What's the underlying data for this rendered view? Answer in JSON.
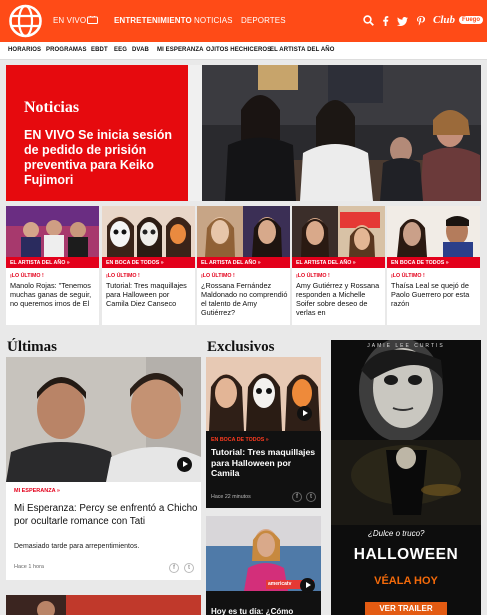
{
  "header": {
    "nav": [
      {
        "label": "EN VIVO"
      },
      {
        "label": "ENTRETENIMIENTO"
      },
      {
        "label": "NOTICIAS"
      },
      {
        "label": "DEPORTES"
      }
    ],
    "club_label": "Club",
    "club_badge": "Fuego",
    "brand_color": "#ff4b17"
  },
  "subnav": [
    "HORARIOS",
    "PROGRAMAS",
    "EBDT",
    "EEG",
    "DVAB",
    "MI ESPERANZA",
    "OJITOS HECHICEROS",
    "EL ARTISTA DEL AÑO"
  ],
  "hero": {
    "section": "Noticias",
    "title": "EN VIVO Se inicia sesión de pedido de prisión preventiva para Keiko Fujimori"
  },
  "cards": [
    {
      "tag": "EL ARTISTA DEL AÑO »",
      "kicker": "¡LO ÚLTIMO !",
      "title": "Manolo Rojas: \"Tenemos muchas ganas de seguir, no queremos irnos de El"
    },
    {
      "tag": "EN BOCA DE TODOS »",
      "kicker": "¡LO ÚLTIMO !",
      "title": "Tutorial: Tres maquillajes para Halloween por Camila Diez Canseco"
    },
    {
      "tag": "EL ARTISTA DEL AÑO »",
      "kicker": "¡LO ÚLTIMO !",
      "title": "¿Rossana Fernández Maldonado no comprendió el talento de Amy Gutiérrez?"
    },
    {
      "tag": "EL ARTISTA DEL AÑO »",
      "kicker": "¡LO ÚLTIMO !",
      "title": "Amy Gutiérrez y Rossana responden a Michelle Soifer sobre deseo de verlas en"
    },
    {
      "tag": "EN BOCA DE TODOS »",
      "kicker": "¡LO ÚLTIMO !",
      "title": "Thaísa Leal se quejó de Paolo Guerrero por esta razón"
    }
  ],
  "ultimas": {
    "heading": "Últimas",
    "kicker": "MI ESPERANZA »",
    "title": "Mi Esperanza: Percy se enfrentó a Chicho por ocultarle romance con Tati",
    "description": "Demasiado tarde para arrepentimientos.",
    "time": "Hace 1 hora"
  },
  "exclusivos": {
    "heading": "Exclusivos",
    "tag": "EN BOCA DE TODOS »",
    "title": "Tutorial: Tres maquillajes para Halloween por Camila",
    "time": "Hace 22 minutos",
    "second_title": "Hoy es tu día: ¿Cómo",
    "second_watermark": "americatv"
  },
  "ad": {
    "brand": "JAMIE LEE CURTIS",
    "tagline": "¿Dulce o truco?",
    "title": "HALLOWEEN",
    "subtitle": "VÉALA HOY",
    "button": "VER TRAILER"
  }
}
